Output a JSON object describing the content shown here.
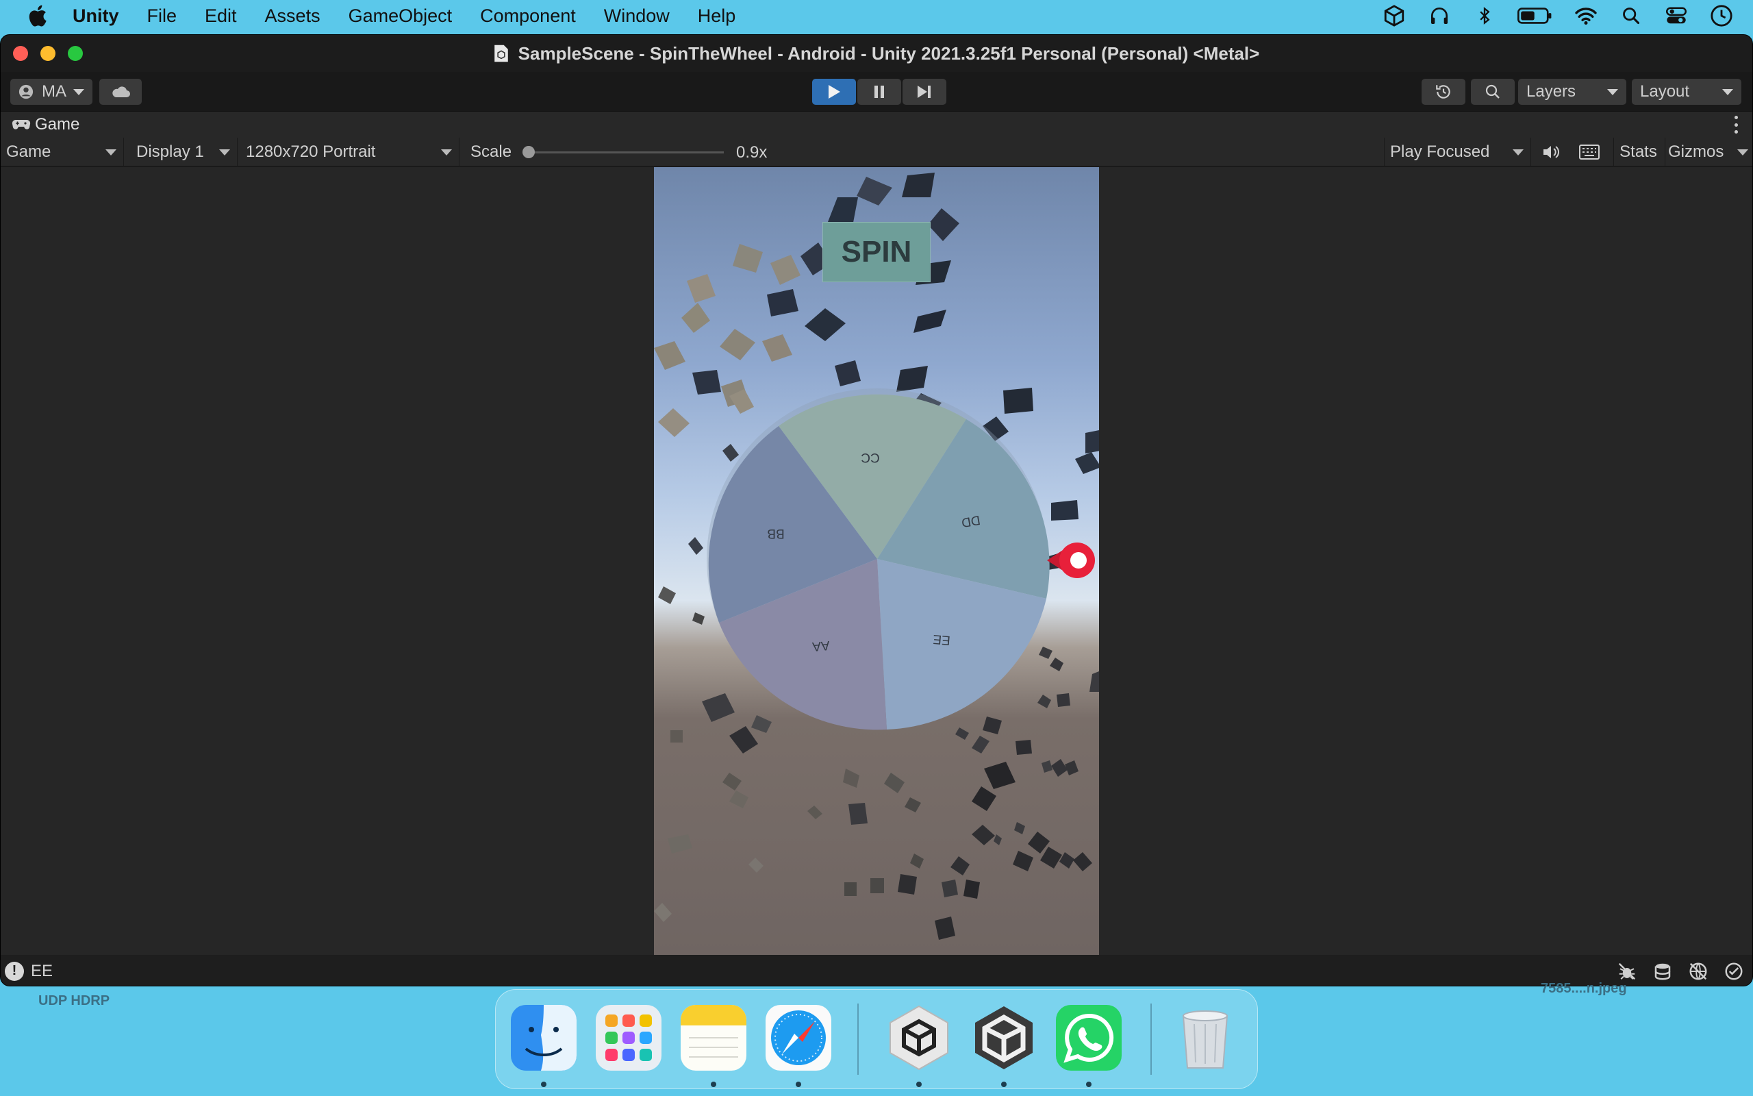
{
  "menubar": {
    "app_name": "Unity",
    "items": [
      "File",
      "Edit",
      "Assets",
      "GameObject",
      "Component",
      "Window",
      "Help"
    ]
  },
  "window": {
    "title": "SampleScene - SpinTheWheel - Android - Unity 2021.3.25f1 Personal (Personal) <Metal>"
  },
  "toolbar": {
    "account_label": "MA",
    "layers_label": "Layers",
    "layout_label": "Layout"
  },
  "tab": {
    "label": "Game"
  },
  "gamebar": {
    "mode": "Game",
    "display": "Display 1",
    "resolution": "1280x720 Portrait",
    "scale_label": "Scale",
    "scale_value": "0.9x",
    "scale_fraction": 0.0,
    "play_mode": "Play Focused",
    "stats_label": "Stats",
    "gizmos_label": "Gizmos"
  },
  "game": {
    "spin_label": "SPIN",
    "wheel_segments": [
      "AA",
      "BB",
      "CC",
      "DD",
      "EE"
    ],
    "wheel_colors": [
      "#8a8aa6",
      "#7687a7",
      "#94aca7",
      "#7f9fb0",
      "#8fa6c4"
    ],
    "pointer_color": "#e8203a"
  },
  "status": {
    "message": "EE"
  },
  "desktop": {
    "label_left": "UDP HDRP",
    "label_right": "7585....n.jpeg"
  },
  "dock": {
    "apps": [
      "finder-icon",
      "launchpad-icon",
      "notes-icon",
      "safari-icon",
      "unity-hub-icon",
      "unity-editor-icon",
      "whatsapp-icon",
      "trash-icon"
    ]
  }
}
